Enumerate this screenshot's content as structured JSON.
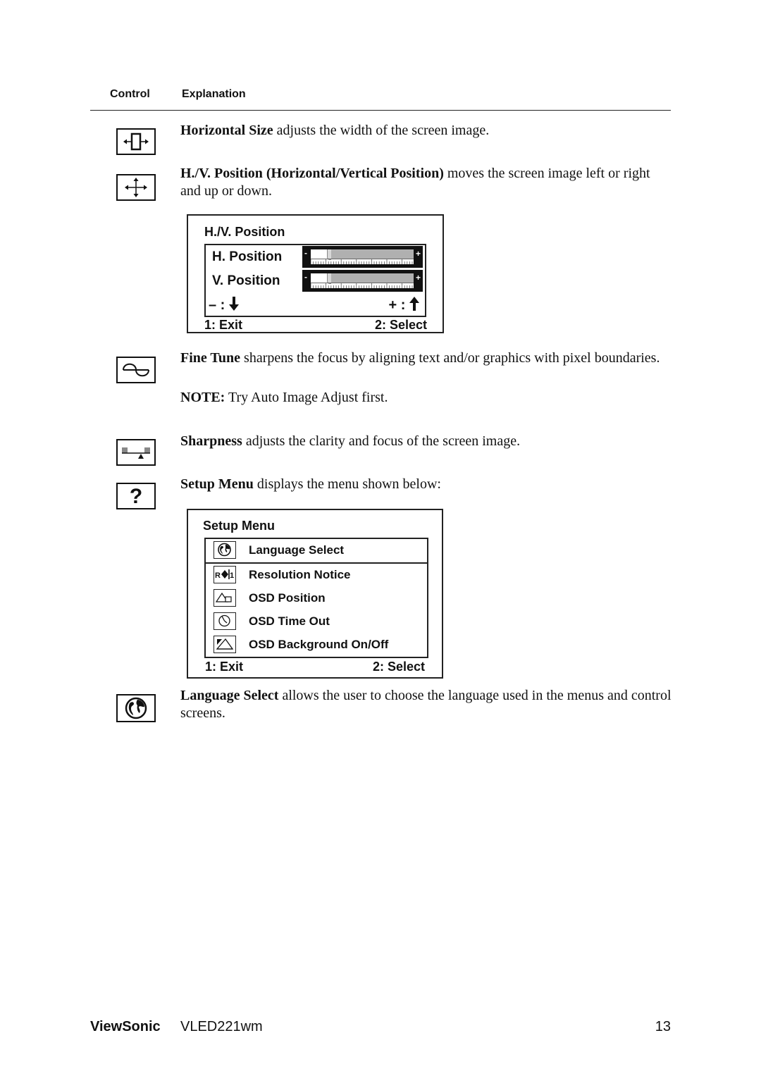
{
  "table_header": {
    "control": "Control",
    "explanation": "Explanation"
  },
  "entries": [
    {
      "icon": "horizontal-size-icon",
      "bold": "Horizontal Size",
      "text": " adjusts the width of the screen image."
    },
    {
      "icon": "hv-position-icon",
      "bold": "H./V. Position (Horizontal/Vertical Position)",
      "text": " moves the screen image left or right and up or down."
    },
    {
      "icon": "fine-tune-icon",
      "bold": "Fine Tune",
      "text": " sharpens the focus by aligning text and/or graphics with pixel boundaries.",
      "note_bold": "NOTE:",
      "note_text": " Try Auto Image Adjust first."
    },
    {
      "icon": "sharpness-icon",
      "bold": "Sharpness",
      "text": " adjusts the clarity and focus of the screen image."
    },
    {
      "icon": "setup-menu-icon",
      "icon_glyph": "?",
      "bold": "Setup Menu",
      "text": " displays the menu shown below:"
    },
    {
      "icon": "language-globe-icon",
      "bold": "Language Select",
      "text": " allows the user to choose the language used in the menus and control screens."
    }
  ],
  "hv_osd": {
    "title": "H./V. Position",
    "rows": [
      {
        "label": "H. Position",
        "value_fraction": 0.16,
        "minus": "-",
        "plus": "+"
      },
      {
        "label": "V. Position",
        "value_fraction": 0.16,
        "minus": "-",
        "plus": "+"
      }
    ],
    "minus_hint": "– :",
    "plus_hint": "+ :",
    "exit": "1: Exit",
    "select": "2: Select"
  },
  "setup_osd": {
    "title": "Setup Menu",
    "items": [
      {
        "label": "Language Select",
        "icon": "globe-icon",
        "selected": true
      },
      {
        "label": "Resolution Notice",
        "icon": "resolution-notice-icon",
        "selected": false
      },
      {
        "label": "OSD Position",
        "icon": "osd-position-icon",
        "selected": false
      },
      {
        "label": "OSD Time Out",
        "icon": "osd-timeout-icon",
        "selected": false
      },
      {
        "label": "OSD Background On/Off",
        "icon": "osd-background-icon",
        "selected": false
      }
    ],
    "exit": "1: Exit",
    "select": "2: Select"
  },
  "footer": {
    "brand": "ViewSonic",
    "model": "VLED221wm",
    "page_number": "13"
  }
}
